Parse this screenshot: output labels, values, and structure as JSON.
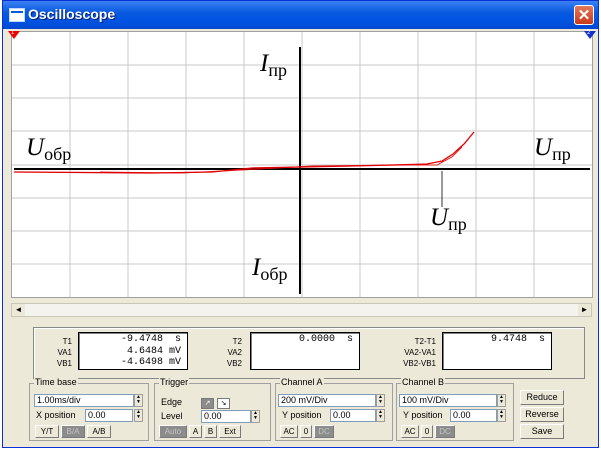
{
  "window": {
    "title": "Oscilloscope",
    "close_symbol": "✕"
  },
  "markers": {
    "t1": "1",
    "t2": "2"
  },
  "plot": {
    "labels": {
      "i_fwd": {
        "main": "I",
        "sub": "пр"
      },
      "u_rev": {
        "main": "U",
        "sub": "обр"
      },
      "u_fwd_axis": {
        "main": "U",
        "sub": "пр"
      },
      "u_threshold": {
        "main": "U",
        "sub": "пр"
      },
      "i_rev": {
        "main": "I",
        "sub": "обр"
      }
    },
    "colors": {
      "trace": "#e00000",
      "axes": "#000000",
      "grid": "#c8c8c8"
    }
  },
  "scrollbar": {
    "left": "◄",
    "right": "►"
  },
  "measurements": {
    "cursor1": {
      "labels": [
        "T1",
        "VA1",
        "VB1"
      ],
      "values": [
        "-9.4748  s",
        "4.6484 mV",
        "-4.6498 mV"
      ]
    },
    "cursor2": {
      "labels": [
        "T2",
        "VA2",
        "VB2"
      ],
      "values": [
        "0.0000  s",
        "",
        ""
      ]
    },
    "diff": {
      "labels": [
        "T2-T1",
        "VA2-VA1",
        "VB2-VB1"
      ],
      "values": [
        "9.4748  s",
        "",
        ""
      ]
    }
  },
  "timebase": {
    "title": "Time base",
    "scale": "1.00ms/div",
    "xpos_label": "X position",
    "xpos": "0.00",
    "modes": [
      "Y/T",
      "B/A",
      "A/B"
    ]
  },
  "trigger": {
    "title": "Trigger",
    "edge_label": "Edge",
    "level_label": "Level",
    "level": "0.00",
    "edge_rise": "↗",
    "edge_fall": "↘",
    "sources": [
      "Auto",
      "A",
      "B",
      "Ext"
    ]
  },
  "channel_a": {
    "title": "Channel A",
    "scale": "200 mV/Div",
    "ypos_label": "Y position",
    "ypos": "0.00",
    "coupling": [
      "AC",
      "0",
      "DC"
    ]
  },
  "channel_b": {
    "title": "Channel B",
    "scale": "100 mV/Div",
    "ypos_label": "Y position",
    "ypos": "0.00",
    "coupling": [
      "AC",
      "0",
      "DC"
    ]
  },
  "actions": {
    "reduce": "Reduce",
    "reverse": "Reverse",
    "save": "Save"
  }
}
